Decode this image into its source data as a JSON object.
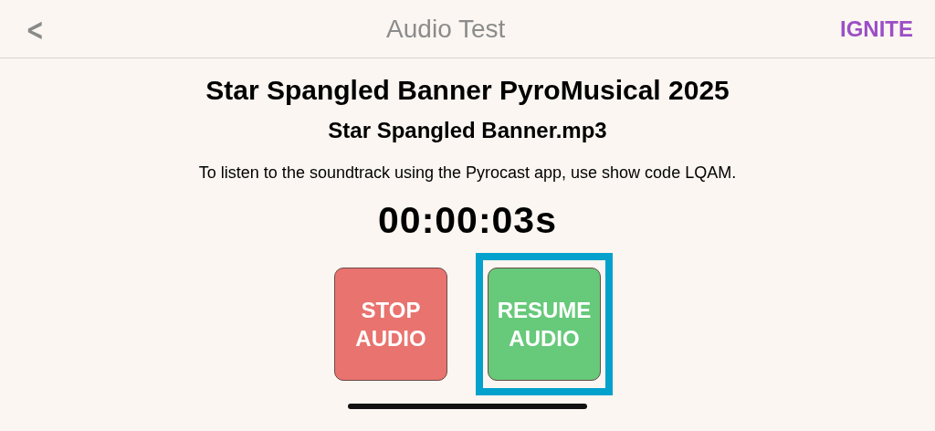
{
  "header": {
    "back": "<",
    "title": "Audio Test",
    "logo": "IGNITE"
  },
  "show_title": "Star Spangled Banner PyroMusical 2025",
  "file_name": "Star Spangled Banner.mp3",
  "instructions": "To listen to the soundtrack using the Pyrocast app, use show code LQAM.",
  "timer": "00:00:03s",
  "buttons": [
    {
      "label": "STOP AUDIO",
      "color": "#e9736e",
      "selected": false
    },
    {
      "label": "RESUME AUDIO",
      "color": "#67c97a",
      "selected": true
    }
  ]
}
